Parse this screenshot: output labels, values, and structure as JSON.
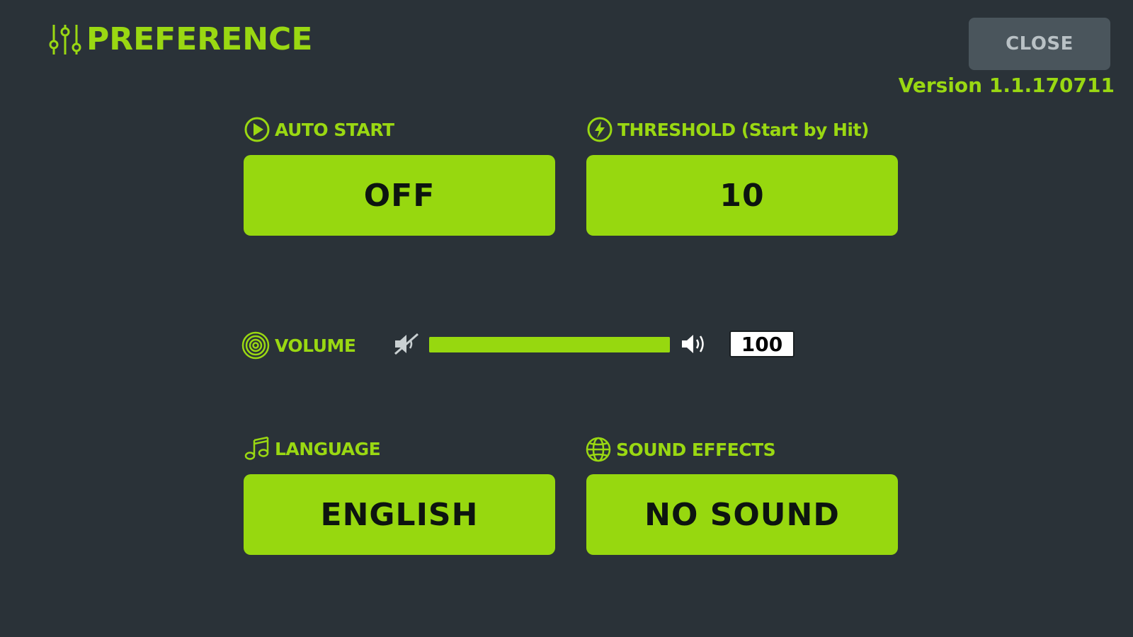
{
  "header": {
    "title": "PREFERENCE",
    "title_icon": "sliders-icon",
    "close_label": "CLOSE",
    "version": "Version 1.1.170711"
  },
  "auto_start": {
    "label": "AUTO START",
    "icon": "play-circle-icon",
    "value": "OFF"
  },
  "threshold": {
    "label": "THRESHOLD (Start by Hit)",
    "icon": "lightning-circle-icon",
    "value": "10"
  },
  "volume": {
    "label": "VOLUME",
    "icon": "concentric-circles-icon",
    "mute_icon": "speaker-muted-icon",
    "max_icon": "speaker-loud-icon",
    "value": "100",
    "level_percent": 100
  },
  "language": {
    "label": "LANGUAGE",
    "icon": "music-note-icon",
    "value": "ENGLISH"
  },
  "sound_effects": {
    "label": "SOUND EFFECTS",
    "icon": "globe-icon",
    "value": "NO SOUND"
  },
  "colors": {
    "background": "#2a3238",
    "accent": "#9ad812",
    "button": "#97d80f",
    "close_button": "#4a555c"
  }
}
